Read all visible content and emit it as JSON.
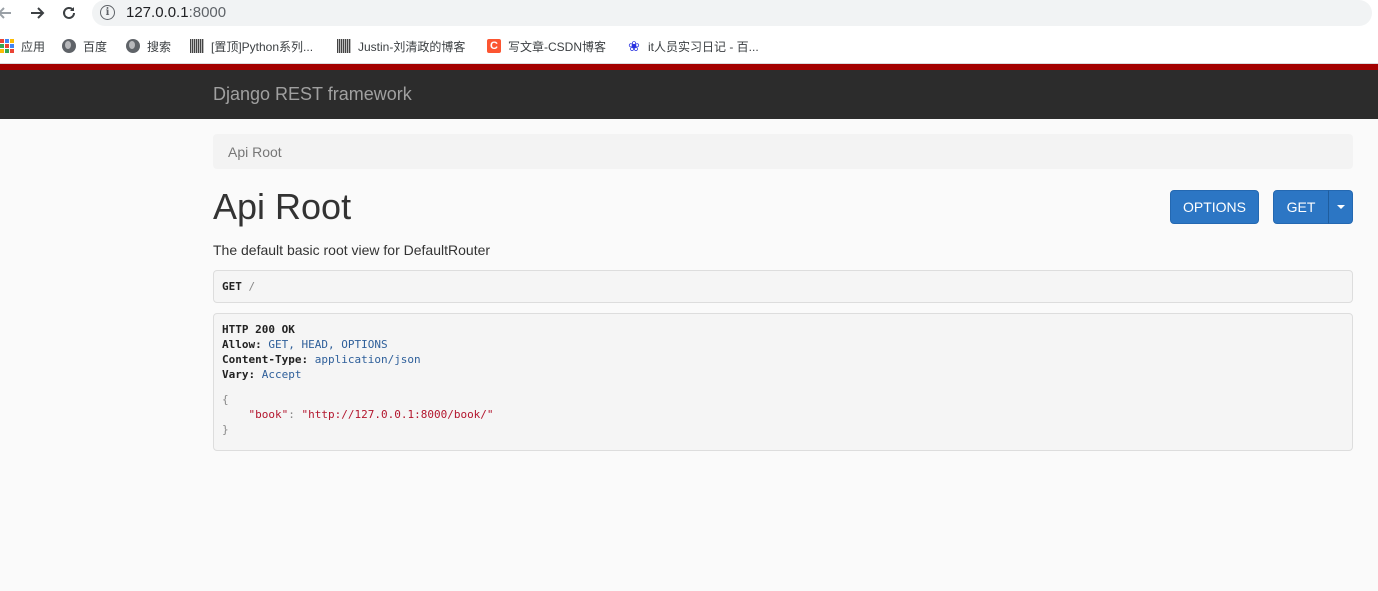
{
  "browser": {
    "url_host": "127.0.0.1",
    "url_port": ":8000",
    "bookmarks": [
      {
        "label": "应用",
        "icon": "apps-grid-icon"
      },
      {
        "label": "百度",
        "icon": "globe-icon"
      },
      {
        "label": "搜索",
        "icon": "globe-icon"
      },
      {
        "label": "[置顶]Python系列...",
        "icon": "qr-favicon-icon"
      },
      {
        "label": "Justin-刘清政的博客",
        "icon": "qr-favicon-icon"
      },
      {
        "label": "写文章-CSDN博客",
        "icon": "csdn-icon"
      },
      {
        "label": "it人员实习日记 - 百...",
        "icon": "baidu-paw-icon"
      }
    ],
    "colors": {
      "csdn": "#fc5531",
      "baidu": "#2932e1"
    }
  },
  "navbar": {
    "brand": "Django REST framework",
    "accent": "#a30000",
    "background": "#2c2c2c"
  },
  "breadcrumb": {
    "current": "Api Root"
  },
  "page": {
    "title": "Api Root",
    "description": "The default basic root view for DefaultRouter",
    "options_label": "OPTIONS",
    "get_label": "GET",
    "button_color": "#2c76c4"
  },
  "request": {
    "method": "GET",
    "path": "/"
  },
  "response": {
    "status": "HTTP 200 OK",
    "headers": [
      {
        "name": "Allow:",
        "value": "GET, HEAD, OPTIONS"
      },
      {
        "name": "Content-Type:",
        "value": "application/json"
      },
      {
        "name": "Vary:",
        "value": "Accept"
      }
    ],
    "open_brace": "{",
    "body_key": "\"book\"",
    "colon": ": ",
    "body_value": "\"http://127.0.0.1:8000/book/\"",
    "close_brace": "}"
  }
}
